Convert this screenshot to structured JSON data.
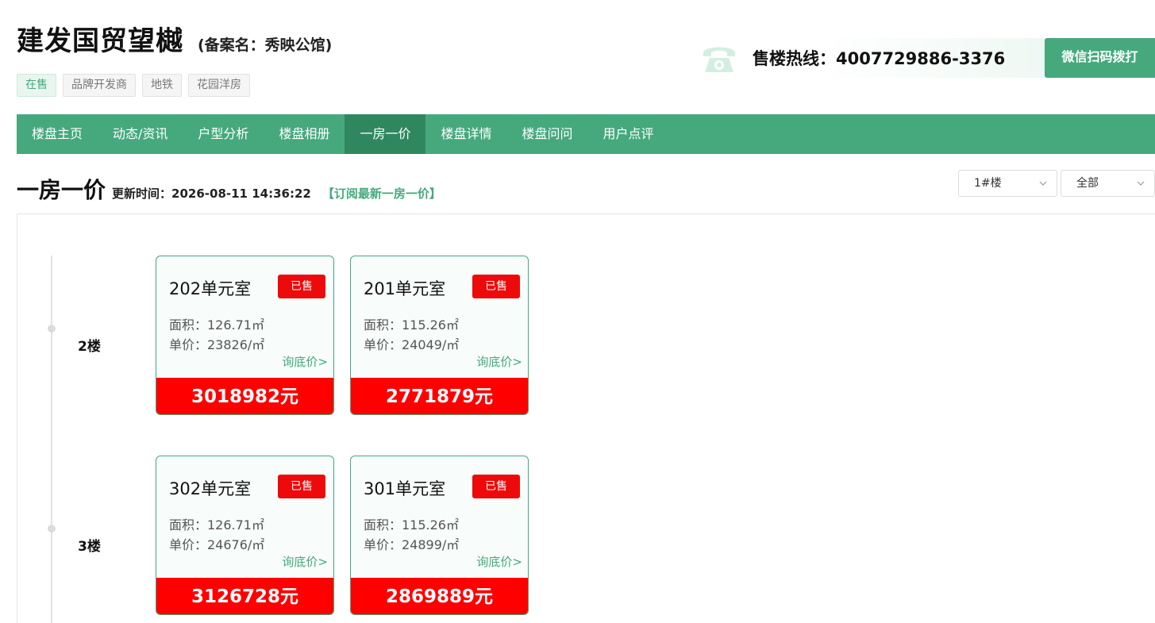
{
  "header": {
    "title": "建发国贸望樾",
    "record_name": "(备案名：秀映公馆)",
    "tags": [
      "在售",
      "品牌开发商",
      "地铁",
      "花园洋房"
    ],
    "hotline": "售楼热线：4007729886-3376",
    "scan_button": "微信扫码拨打"
  },
  "nav": {
    "items": [
      "楼盘主页",
      "动态/资讯",
      "户型分析",
      "楼盘相册",
      "一房一价",
      "楼盘详情",
      "楼盘问问",
      "用户点评"
    ],
    "active": "一房一价"
  },
  "section": {
    "title": "一房一价",
    "update_label": "更新时间：",
    "update_time": "2026-08-11 14:36:22",
    "subscribe": "【订阅最新一房一价】"
  },
  "filters": {
    "building": "1#楼",
    "status": "全部"
  },
  "floors": [
    {
      "label": "2楼",
      "units": [
        {
          "name": "202单元室",
          "status": "已售",
          "area": "面积：126.71㎡",
          "price": "单价：23826/㎡",
          "ask": "询底价>",
          "total": "3018982元"
        },
        {
          "name": "201单元室",
          "status": "已售",
          "area": "面积：115.26㎡",
          "price": "单价：24049/㎡",
          "ask": "询底价>",
          "total": "2771879元"
        }
      ]
    },
    {
      "label": "3楼",
      "units": [
        {
          "name": "302单元室",
          "status": "已售",
          "area": "面积：126.71㎡",
          "price": "单价：24676/㎡",
          "ask": "询底价>",
          "total": "3126728元"
        },
        {
          "name": "301单元室",
          "status": "已售",
          "area": "面积：115.26㎡",
          "price": "单价：24899/㎡",
          "ask": "询底价>",
          "total": "2869889元"
        }
      ]
    }
  ],
  "colors": {
    "brand_green": "#45a97d",
    "nav_active": "#2f8760",
    "sold_red": "#ee0a0a",
    "price_red": "#ff0000"
  }
}
